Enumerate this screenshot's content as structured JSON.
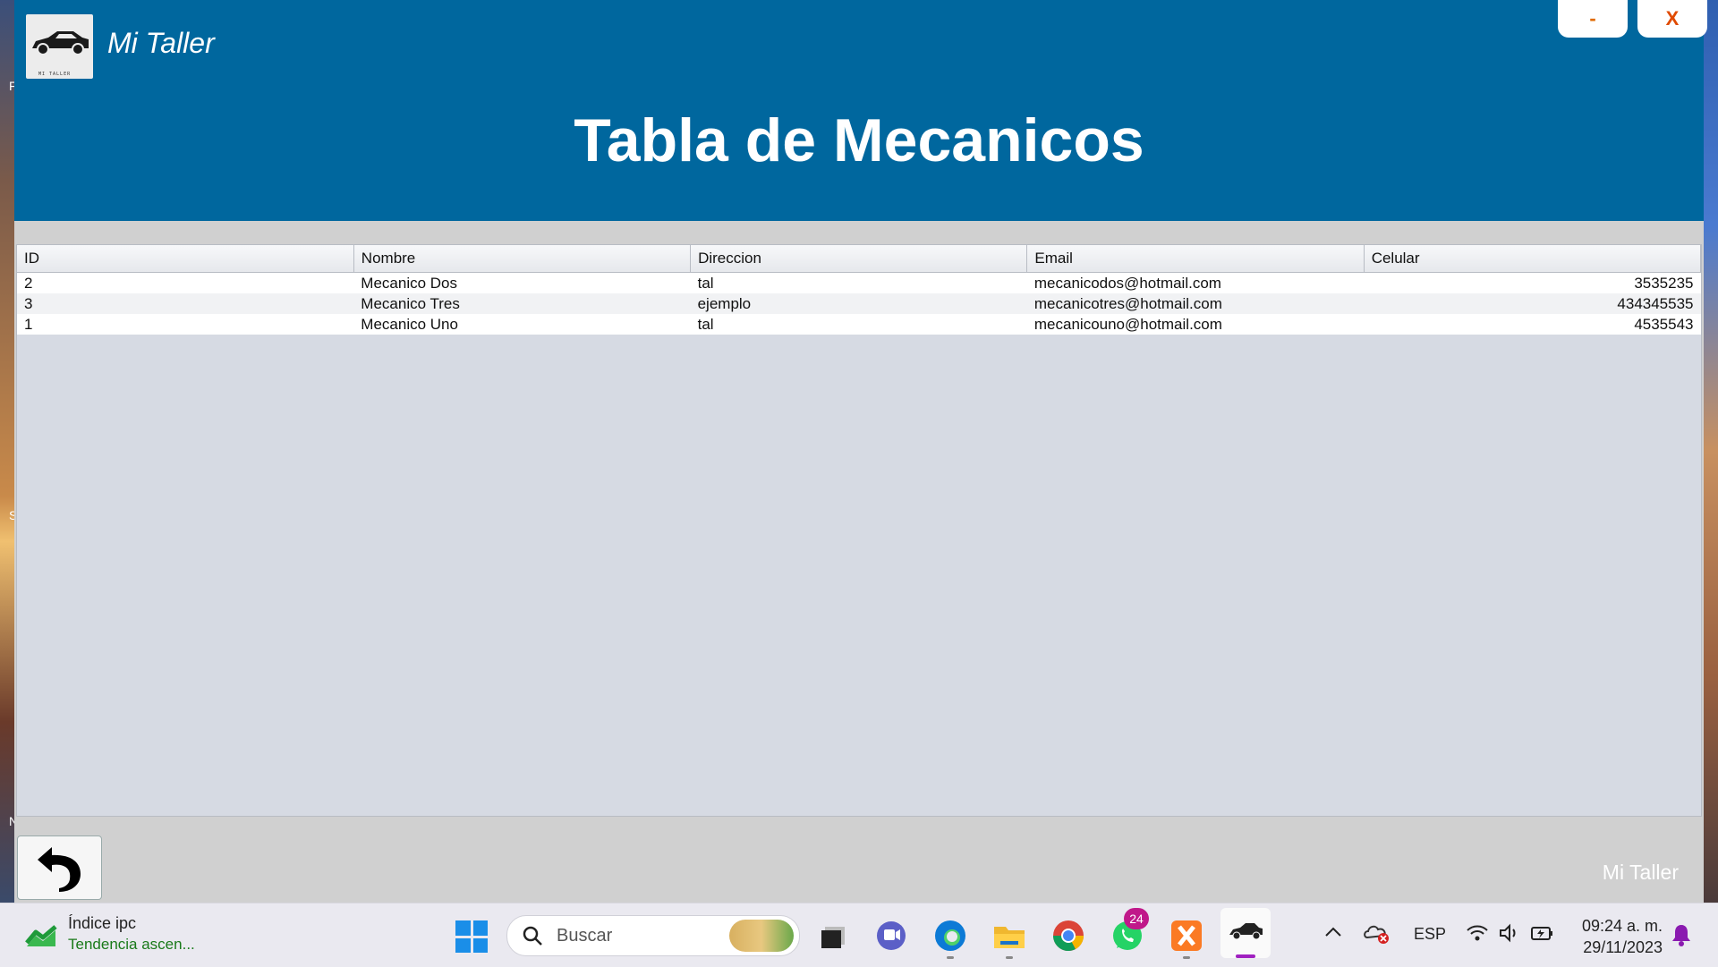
{
  "app": {
    "name": "Mi Taller",
    "logo_text": "MI TALLER",
    "page_title": "Tabla de Mecanicos",
    "minimize_label": "-",
    "close_label": "X",
    "footer_brand": "Mi Taller"
  },
  "table": {
    "columns": [
      "ID",
      "Nombre",
      "Direccion",
      "Email",
      "Celular"
    ],
    "rows": [
      [
        "2",
        "Mecanico Dos",
        "tal",
        "mecanicodos@hotmail.com",
        "3535235"
      ],
      [
        "3",
        "Mecanico Tres",
        "ejemplo",
        "mecanicotres@hotmail.com",
        "434345535"
      ],
      [
        "1",
        "Mecanico Uno",
        "tal",
        "mecanicouno@hotmail.com",
        "4535543"
      ]
    ]
  },
  "taskbar": {
    "widget_title": "Índice ipc",
    "widget_subtitle": "Tendencia ascen...",
    "search_placeholder": "Buscar",
    "whatsapp_badge": "24",
    "language": "ESP",
    "time": "09:24 a. m.",
    "date": "29/11/2023"
  },
  "wallpaper": {
    "left_chars": [
      "F",
      "S",
      "N"
    ]
  },
  "colors": {
    "header": "#00679e",
    "accent": "#e06a00"
  }
}
